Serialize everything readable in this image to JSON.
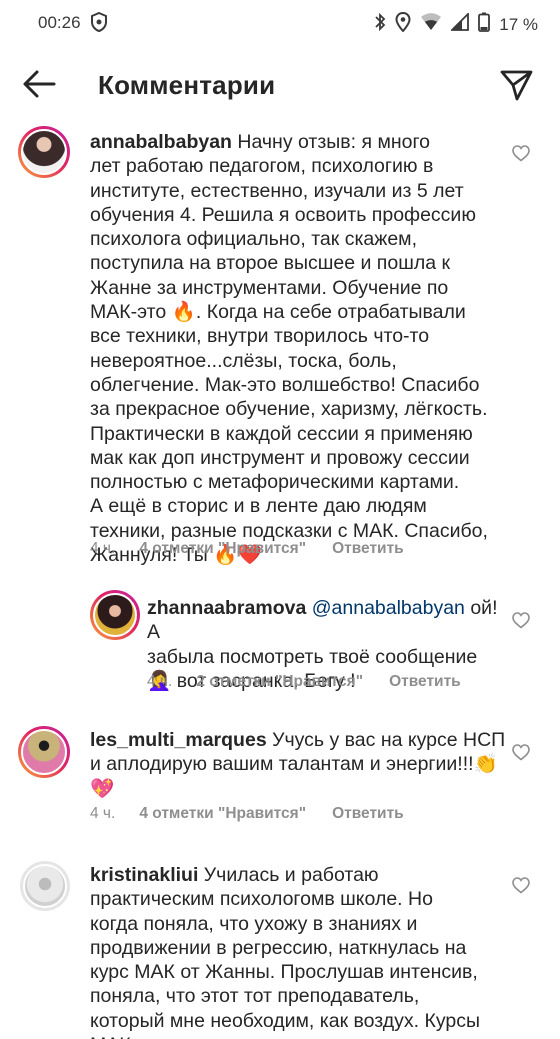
{
  "status_bar": {
    "time": "00:26",
    "battery": "17 %",
    "icons": [
      "shield-icon",
      "bluetooth-icon",
      "location-icon",
      "wifi-icon",
      "signal-icon"
    ]
  },
  "header": {
    "title": "Комментарии",
    "back_icon": "arrow-left-icon",
    "send_icon": "paper-plane-icon"
  },
  "comments": [
    {
      "username": "annabalbabyan",
      "text": "Начну отзыв: я много\nлет работаю педагогом, психологию в\nинституте, естественно, изучали из 5 лет\nобучения 4. Решила я освоить профессию\nпсихолога официально, так скажем,\nпоступила на второе высшее и пошла к\nЖанне за инструментами. Обучение по\nМАК-это 🔥. Когда на себе отрабатывали\nвсе техники, внутри творилось что-то\nневероятное...слёзы, тоска, боль,\nоблегчение. Мак-это волшебство! Спасибо\nза прекрасное обучение, харизму, лёгкость.\nПрактически в каждой сессии я применяю\nмак как доп инструмент и провожу сессии\nполностью с метафорическими картами.\nА ещё в сторис и в ленте даю людям\nтехники, разные подсказки с МАК. Спасибо,\nЖаннуля! Ты 🔥❤️",
      "time": "4 ч.",
      "likes": "4 отметки \"Нравится\"",
      "reply": "Ответить",
      "avatar_colors": [
        "#3b2a2a",
        "#d9b8a8"
      ]
    },
    {
      "username": "zhannaabramova",
      "mention": "@annabalbabyan",
      "text": " ой! А\nзабыла посмотреть твоё сообщение\n🤦‍♀️ вот засранка. Бегу !",
      "time": "4 ч.",
      "likes": "2 отметки \"Нравится\"",
      "reply": "Ответить",
      "avatar_colors": [
        "#2d1b1b",
        "#e0b23a"
      ]
    },
    {
      "username": "les_multi_marques",
      "text": " Учусь у вас на курсе НСП\nи аплодирую вашим талантам и энергии!!!👏\n💖",
      "time": "4 ч.",
      "likes": "4 отметки \"Нравится\"",
      "reply": "Ответить",
      "avatar_colors": [
        "#c8b37a",
        "#e07aa8"
      ]
    },
    {
      "username": "kristinakliui",
      "text": " Училась и работаю\nпрактическим психологомв школе. Но\nкогда поняла, что ухожу в знаниях и\nпродвижении в регрессию, наткнулась на\nкурс МАК от Жанны. Прослушав интенсив,\nпоняла, что этот тот преподаватель,\nкоторый мне необходим, как воздух. Курсы\nМАК освоила с таким воодушевлением и",
      "avatar_colors": [
        "#d8d8d8",
        "#a0a0a0"
      ]
    }
  ],
  "colors": {
    "text": "#262626",
    "secondary": "#8e8e8e",
    "mention": "#00376b"
  }
}
